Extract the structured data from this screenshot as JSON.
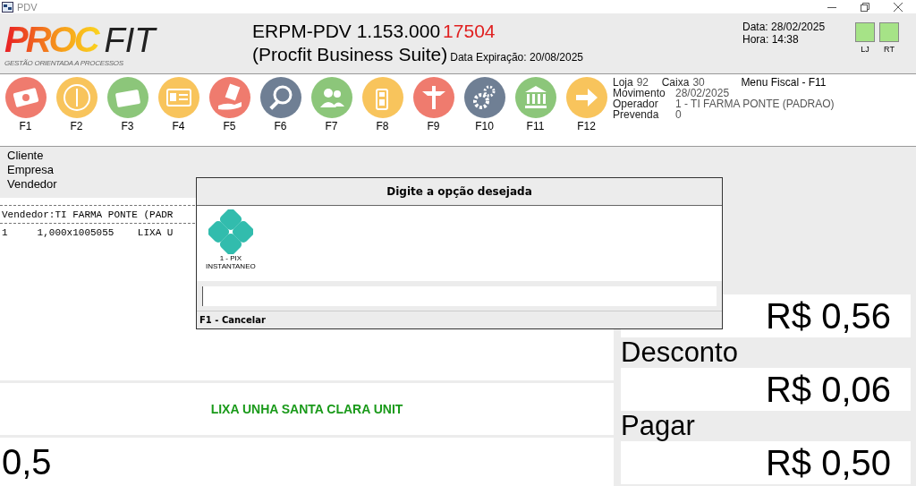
{
  "window": {
    "title": "PDV"
  },
  "header": {
    "logo_primary": "PROC",
    "logo_secondary": "FIT",
    "tagline": "GESTÃO ORIENTADA A PROCESSOS",
    "product": "ERPM-PDV 1.153.000",
    "build": "17504",
    "suite": "(Procfit Business Suite)",
    "expiration": "Data Expiração: 20/08/2025",
    "date_label": "Data:",
    "date": "28/02/2025",
    "time_label": "Hora:",
    "time": "14:38",
    "indicators": [
      {
        "label": "LJ",
        "color": "#a6e387"
      },
      {
        "label": "RT",
        "color": "#a6e387"
      }
    ]
  },
  "toolbar": [
    {
      "label": "F1",
      "color": "#ef7b6e"
    },
    {
      "label": "F2",
      "color": "#f8c45c"
    },
    {
      "label": "F3",
      "color": "#8cc67a"
    },
    {
      "label": "F4",
      "color": "#f8c45c"
    },
    {
      "label": "F5",
      "color": "#ef7b6e"
    },
    {
      "label": "F6",
      "color": "#6f7f94"
    },
    {
      "label": "F7",
      "color": "#8cc67a"
    },
    {
      "label": "F8",
      "color": "#f8c45c"
    },
    {
      "label": "F9",
      "color": "#ef7b6e"
    },
    {
      "label": "F10",
      "color": "#6f7f94"
    },
    {
      "label": "F11",
      "color": "#8cc67a"
    },
    {
      "label": "F12",
      "color": "#f8c45c"
    }
  ],
  "session": {
    "store_label": "Loja",
    "store": "92",
    "register_label": "Caixa",
    "register": "30",
    "fiscal_menu": "Menu Fiscal - F11",
    "movement_label": "Movimento",
    "movement": "28/02/2025",
    "operator_label": "Operador",
    "operator": "1 - TI FARMA PONTE (PADRAO)",
    "presale_label": "Prevenda",
    "presale": "0"
  },
  "customer_labels": [
    "Cliente",
    "Empresa",
    "Vendedor"
  ],
  "receipt_lines": [
    "Vendedor:TI FARMA PONTE (PADR",
    "1     1,000x1005055    LIXA U"
  ],
  "product_name": "LIXA UNHA SANTA CLARA UNIT",
  "quantity": "0,5",
  "totals": [
    {
      "value": "R$ 0,56"
    },
    {
      "label": "Desconto",
      "value": "R$ 0,06"
    },
    {
      "label": "Pagar",
      "value": "R$ 0,50"
    }
  ],
  "dialog": {
    "title": "Digite a opção desejada",
    "options": [
      {
        "line1": "1 - PIX",
        "line2": "INSTANTANEO"
      }
    ],
    "footer": "F1 - Cancelar"
  }
}
